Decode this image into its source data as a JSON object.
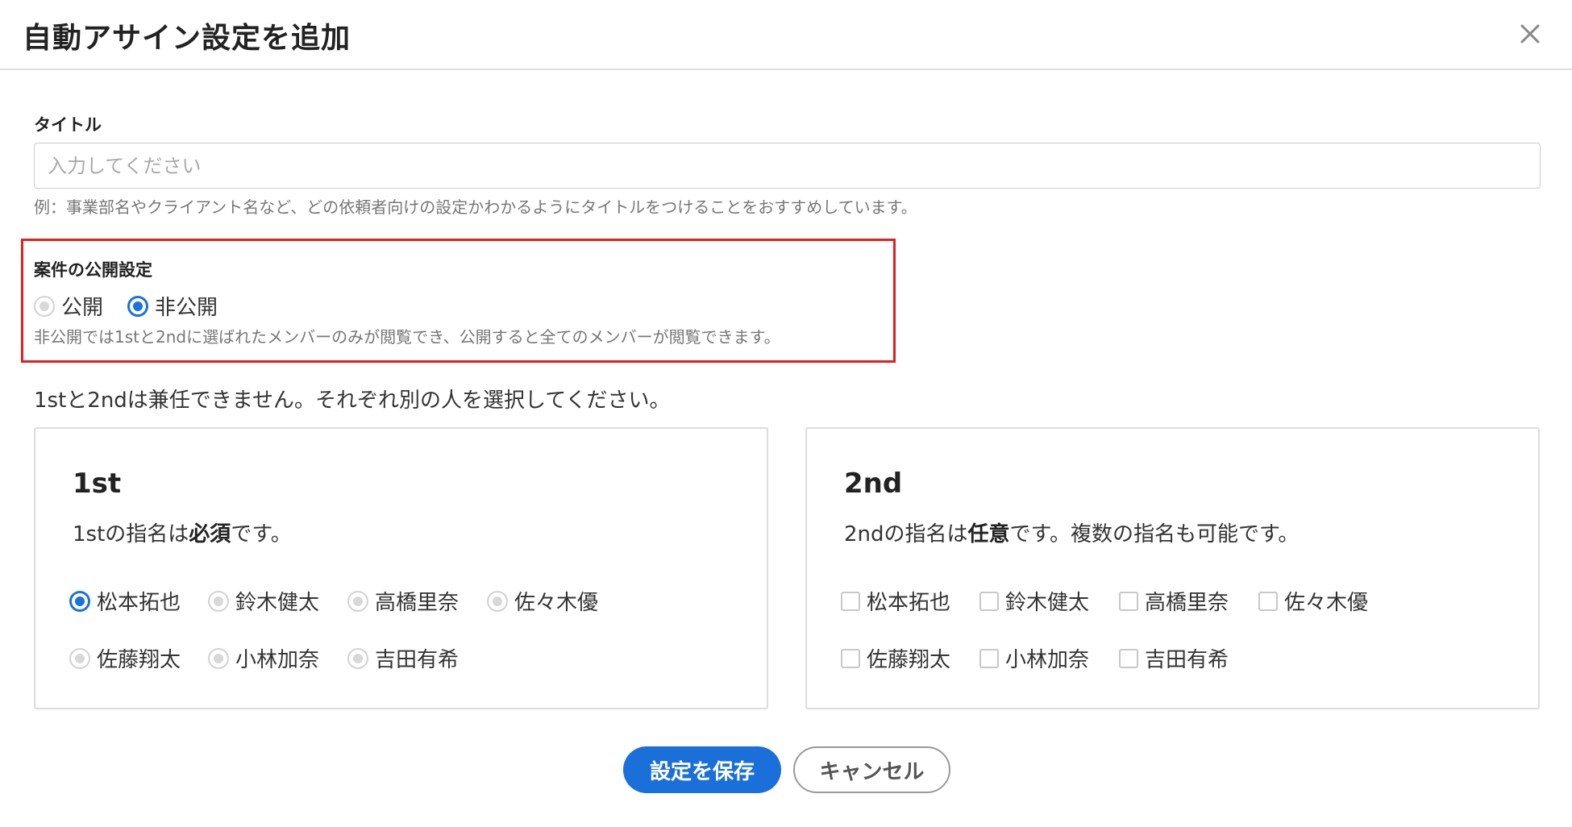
{
  "dialog": {
    "title": "自動アサイン設定を追加",
    "close_icon": "close-icon"
  },
  "title_field": {
    "label": "タイトル",
    "value": "",
    "placeholder": "入力してください",
    "hint": "例：事業部名やクライアント名など、どの依頼者向けの設定かわかるようにタイトルをつけることをおすすめしています。"
  },
  "visibility": {
    "label": "案件の公開設定",
    "options": [
      {
        "label": "公開",
        "selected": false
      },
      {
        "label": "非公開",
        "selected": true
      }
    ],
    "hint": "非公開では1stと2ndに選ばれたメンバーのみが閲覧でき、公開すると全てのメンバーが閲覧できます。"
  },
  "notice": "1stと2ndは兼任できません。それぞれ別の人を選択してください。",
  "first": {
    "title": "1st",
    "desc_prefix": "1stの指名は",
    "desc_bold": "必須",
    "desc_suffix": "です。",
    "members": [
      {
        "name": "松本拓也",
        "selected": true
      },
      {
        "name": "鈴木健太",
        "selected": false
      },
      {
        "name": "高橋里奈",
        "selected": false
      },
      {
        "name": "佐々木優",
        "selected": false
      },
      {
        "name": "佐藤翔太",
        "selected": false
      },
      {
        "name": "小林加奈",
        "selected": false
      },
      {
        "name": "吉田有希",
        "selected": false
      }
    ]
  },
  "second": {
    "title": "2nd",
    "desc_prefix": "2ndの指名は",
    "desc_bold": "任意",
    "desc_suffix": "です。複数の指名も可能です。",
    "members": [
      {
        "name": "松本拓也",
        "checked": false
      },
      {
        "name": "鈴木健太",
        "checked": false
      },
      {
        "name": "高橋里奈",
        "checked": false
      },
      {
        "name": "佐々木優",
        "checked": false
      },
      {
        "name": "佐藤翔太",
        "checked": false
      },
      {
        "name": "小林加奈",
        "checked": false
      },
      {
        "name": "吉田有希",
        "checked": false
      }
    ]
  },
  "actions": {
    "save_label": "設定を保存",
    "cancel_label": "キャンセル"
  },
  "colors": {
    "accent": "#1a73d9",
    "highlight_border": "#e02020"
  }
}
